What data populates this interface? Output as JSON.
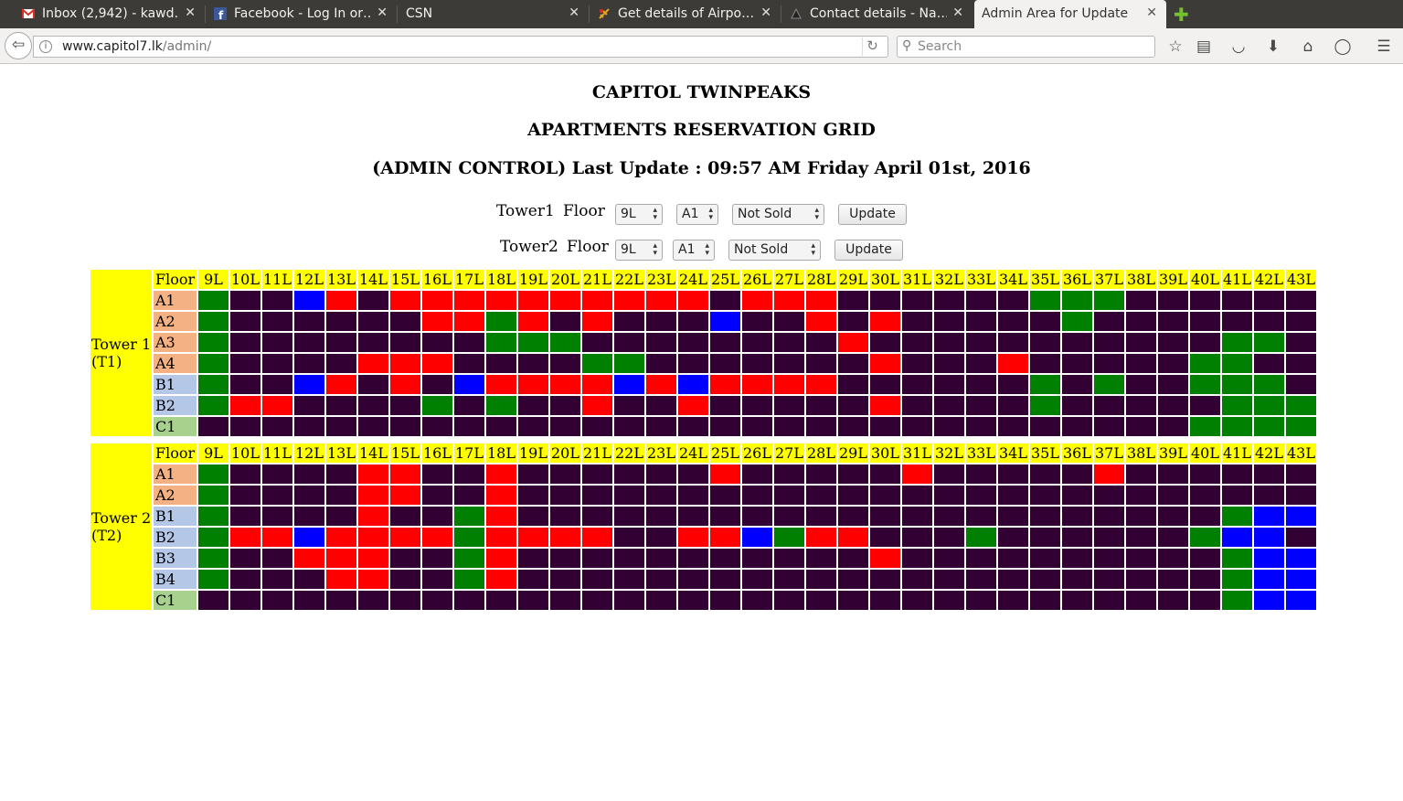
{
  "browser": {
    "tabs": [
      {
        "label": "Inbox (2,942) - kawd…",
        "icon": "gmail-icon",
        "active": false
      },
      {
        "label": "Facebook - Log In or…",
        "icon": "facebook-icon",
        "active": false
      },
      {
        "label": "CSN",
        "icon": "",
        "active": false
      },
      {
        "label": "Get details of Airpo…",
        "icon": "airport-icon",
        "active": false
      },
      {
        "label": "Contact details - Na…",
        "icon": "contact-icon",
        "active": false
      },
      {
        "label": "Admin Area for Update",
        "icon": "",
        "active": true
      }
    ],
    "url_host": "www.capitol7.lk",
    "url_path": "/admin/",
    "search_placeholder": "Search",
    "toolbar_icons": [
      "bookmark-star-icon",
      "reader-list-icon",
      "pocket-icon",
      "download-icon",
      "home-icon",
      "chat-icon",
      "menu-icon"
    ]
  },
  "page": {
    "title": "CAPITOL TWINPEAKS",
    "subtitle": "APARTMENTS RESERVATION GRID",
    "update_line": "(ADMIN CONTROL) Last Update : 09:57 AM Friday April 01st, 2016",
    "controls": [
      {
        "tower_label": "Tower1",
        "floor_label": "Floor",
        "floor_value": "9L",
        "unit_value": "A1",
        "status_value": "Not Sold",
        "button_label": "Update"
      },
      {
        "tower_label": "Tower2",
        "floor_label": "Floor",
        "floor_value": "9L",
        "unit_value": "A1",
        "status_value": "Not Sold",
        "button_label": "Update"
      }
    ]
  },
  "grid": {
    "floor_header": "Floor",
    "floors": [
      "9L",
      "10L",
      "11L",
      "12L",
      "13L",
      "14L",
      "15L",
      "16L",
      "17L",
      "18L",
      "19L",
      "20L",
      "21L",
      "22L",
      "23L",
      "24L",
      "25L",
      "26L",
      "27L",
      "28L",
      "29L",
      "30L",
      "31L",
      "32L",
      "33L",
      "34L",
      "35L",
      "36L",
      "37L",
      "38L",
      "39L",
      "40L",
      "41L",
      "42L",
      "43L"
    ],
    "legend_colors": {
      "g": "#008000",
      "r": "#ff0000",
      "b": "#0000ff",
      "d": "#330033"
    },
    "row_label_colors": {
      "A": "#f4b183",
      "B": "#b4c7e7",
      "C": "#a9d18e"
    },
    "towers": [
      {
        "label_line1": "Tower 1",
        "label_line2": "(T1)",
        "rows": [
          {
            "unit": "A1",
            "cells": "gddbrdrrrrrrrrrrdrrrddddddgggdddddd"
          },
          {
            "unit": "A2",
            "cells": "gddddddrrgrdrdddbddrdrdddddgddddddd"
          },
          {
            "unit": "A3",
            "cells": "gddddddddgggddddddddrdddddddddddggd"
          },
          {
            "unit": "A4",
            "cells": "gddddrrrddddggdddddddrdddrdddddggd"
          },
          {
            "unit": "B1",
            "cells": "gddbrdrdbrrrrbrbrrrrddddddgdgddgggd"
          },
          {
            "unit": "B2",
            "cells": "grrddddgdgddrddrdddddrddddgdddddgggd"
          },
          {
            "unit": "C1",
            "cells": "dddddddddddddddddddddddddddddddggggg"
          }
        ]
      },
      {
        "label_line1": "Tower 2",
        "label_line2": "(T2)",
        "rows": [
          {
            "unit": "A1",
            "cells": "gddddrrddrddddddrdddddrdddddrdddddd"
          },
          {
            "unit": "A2",
            "cells": "gddddrrddrddddddddddddddddddddddddd"
          },
          {
            "unit": "B1",
            "cells": "gddddrddgrddddddddddddddddddddddgbb"
          },
          {
            "unit": "B2",
            "cells": "grrbrrrrgrrrrddrrbgrrdddgddddddgbb"
          },
          {
            "unit": "B3",
            "cells": "gddrrrddgrdddddddddddrddddddddddgbb"
          },
          {
            "unit": "B4",
            "cells": "gdddrrddgrddddddddddddddddddddddgbb"
          },
          {
            "unit": "C1",
            "cells": "ddddddddddddddddddddddddddddddddgbb"
          }
        ]
      }
    ]
  }
}
